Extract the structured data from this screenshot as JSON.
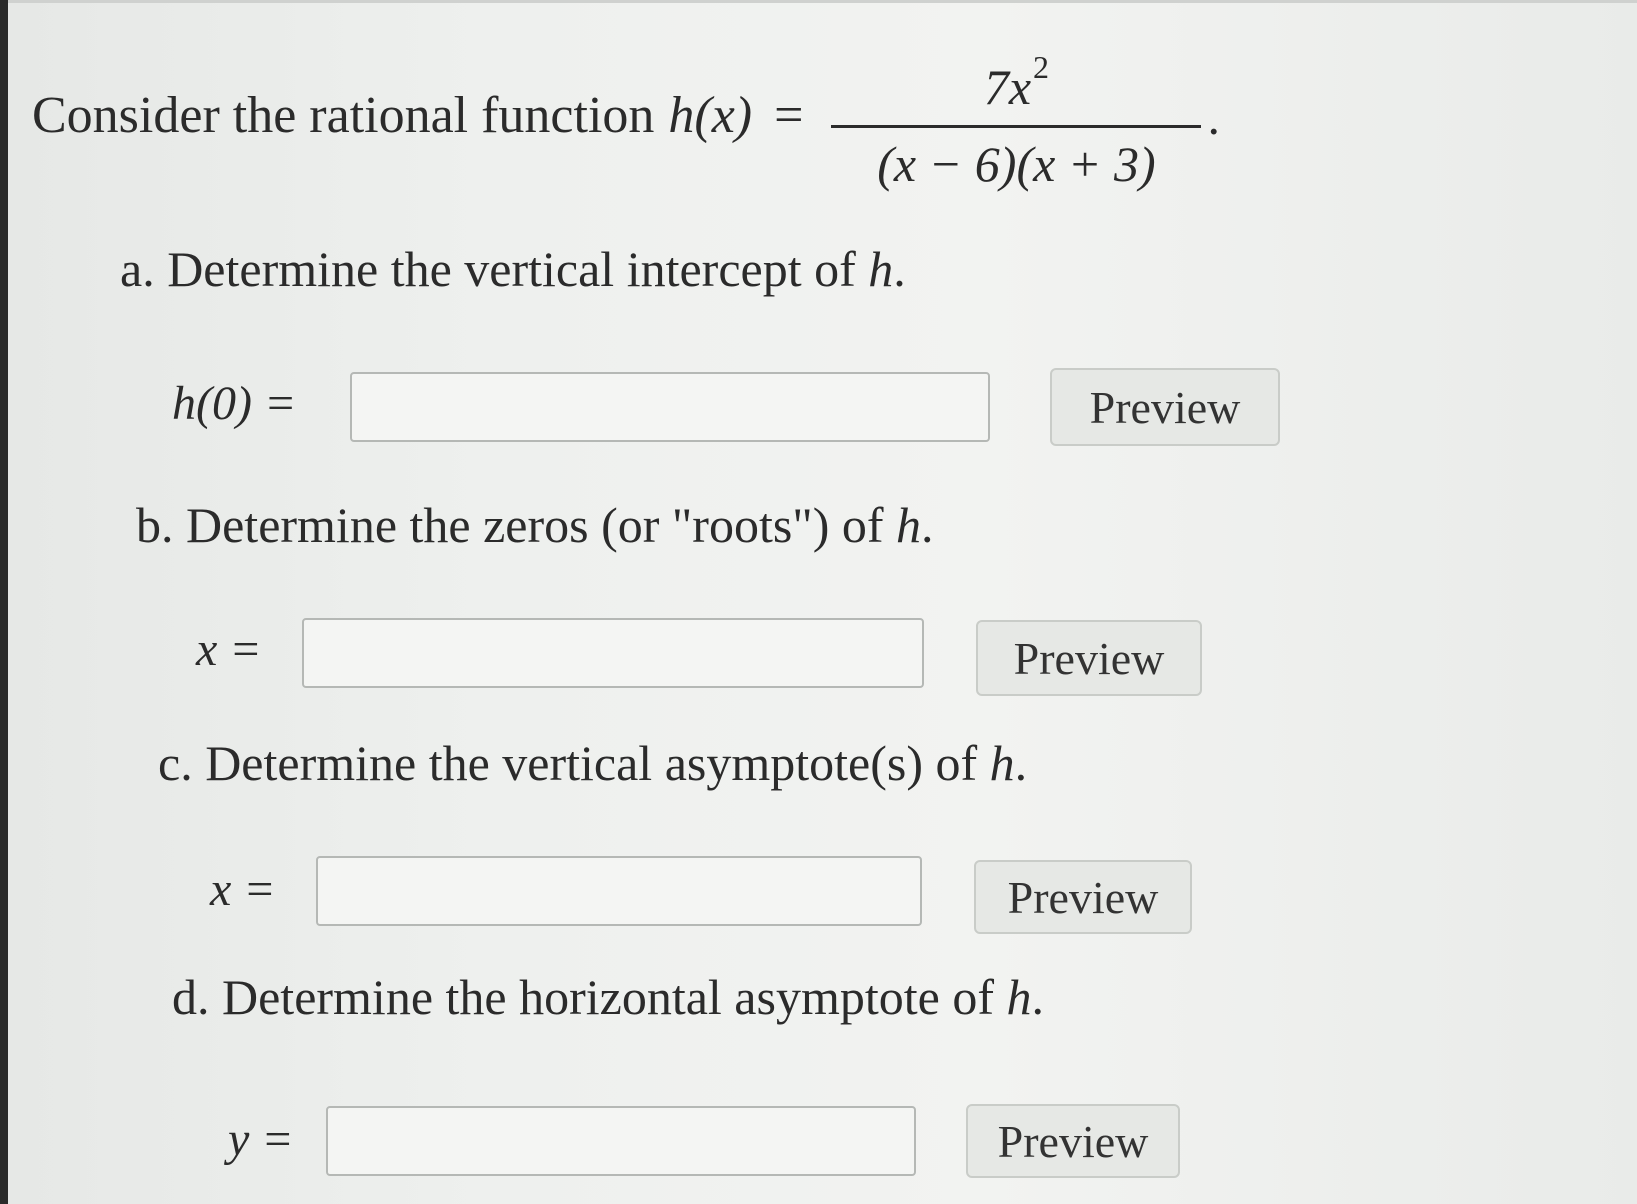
{
  "problem": {
    "intro_text": "Consider the rational function",
    "function_lhs": "h(x)",
    "equals": "=",
    "numerator_base": "7x",
    "numerator_exponent": "2",
    "denominator": "(x − 6)(x + 3)",
    "period": "."
  },
  "parts": [
    {
      "label": "a. Determine the vertical intercept of ",
      "label_var": "h",
      "label_end": ".",
      "lhs": "h(0) =",
      "answer_value": "",
      "preview_label": "Preview"
    },
    {
      "label": "b. Determine the zeros (or \"roots\") of ",
      "label_var": "h",
      "label_end": ".",
      "lhs": "x =",
      "answer_value": "",
      "preview_label": "Preview"
    },
    {
      "label": "c. Determine the vertical asymptote(s) of ",
      "label_var": "h",
      "label_end": ".",
      "lhs": "x =",
      "answer_value": "",
      "preview_label": "Preview"
    },
    {
      "label": "d. Determine the horizontal asymptote of ",
      "label_var": "h",
      "label_end": ".",
      "lhs": "y =",
      "answer_value": "",
      "preview_label": "Preview"
    }
  ]
}
